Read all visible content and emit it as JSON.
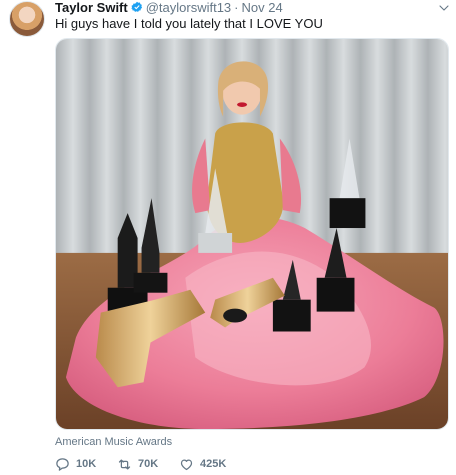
{
  "tweet": {
    "display_name": "Taylor Swift",
    "handle": "@taylorswift13",
    "separator": "·",
    "date": "Nov 24",
    "text": "Hi guys have I told you lately that I LOVE YOU",
    "media_caption": "American Music Awards"
  },
  "actions": {
    "replies": "10K",
    "retweets": "70K",
    "likes": "425K"
  },
  "icons": {
    "verified": "verified-badge-icon",
    "reply": "reply-icon",
    "retweet": "retweet-icon",
    "like": "heart-icon",
    "more": "chevron-down-icon"
  },
  "colors": {
    "verified": "#1da1f2",
    "secondary_text": "#657786",
    "primary_text": "#14171a"
  }
}
